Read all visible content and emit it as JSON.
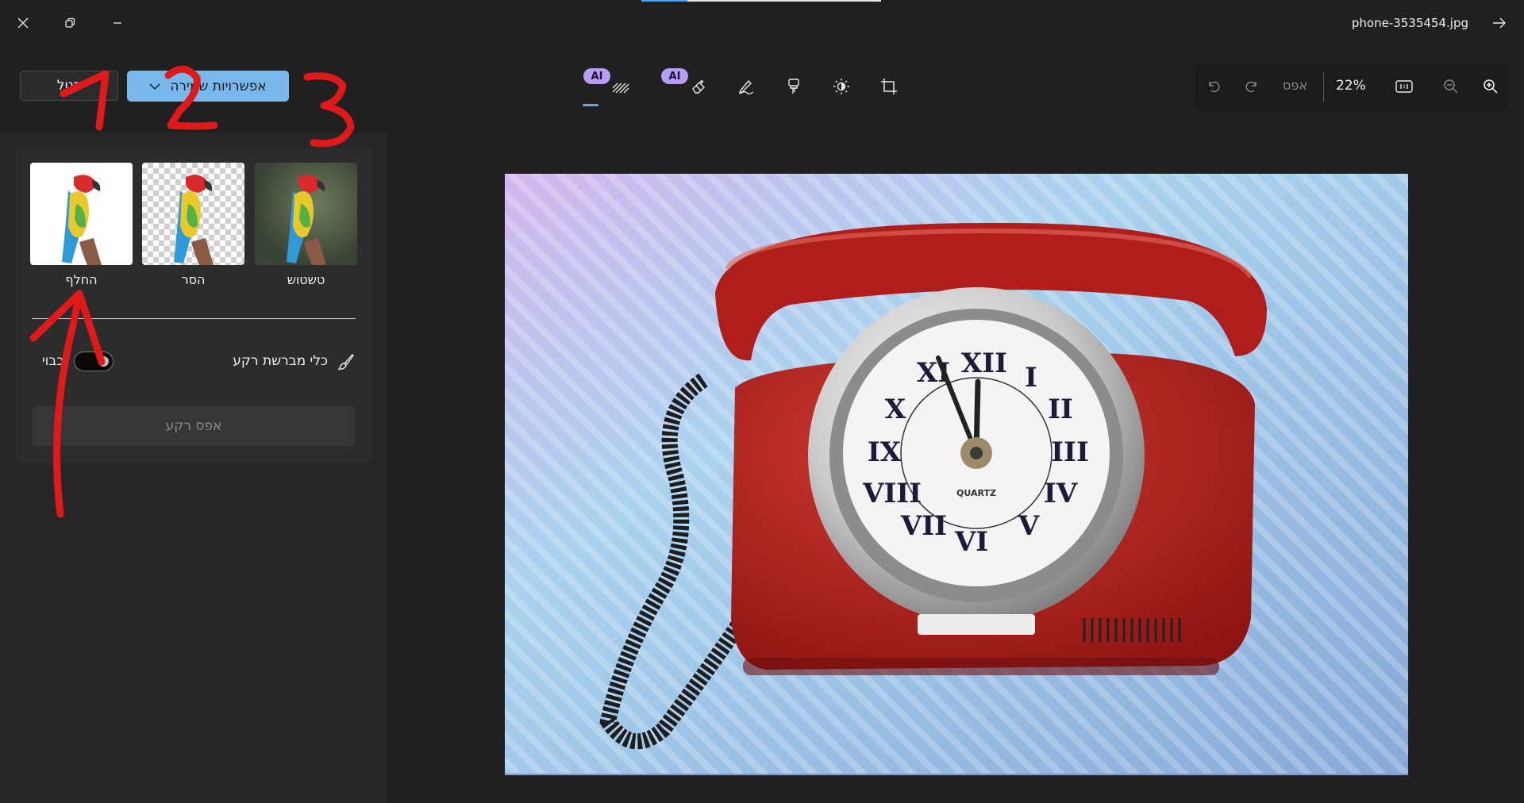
{
  "window": {
    "file_name": "phone-3535454.jpg",
    "close_icon": "close-icon",
    "restore_icon": "restore-icon",
    "minimize_icon": "minimize-icon",
    "forward_icon": "arrow-right-icon"
  },
  "actions": {
    "cancel_label": "בטל",
    "save_label": "אפשרויות שמירה",
    "save_dropdown_icon": "chevron-down-icon"
  },
  "tools": {
    "ai_badge": "AI",
    "items": [
      {
        "name": "background-tool",
        "icon": "background-icon",
        "ai": true,
        "selected": true
      },
      {
        "name": "erase-tool",
        "icon": "eraser-icon",
        "ai": true,
        "selected": false
      },
      {
        "name": "markup-tool",
        "icon": "pen-icon",
        "ai": false,
        "selected": false
      },
      {
        "name": "filter-tool",
        "icon": "filter-icon",
        "ai": false,
        "selected": false
      },
      {
        "name": "adjust-tool",
        "icon": "brightness-icon",
        "ai": false,
        "selected": false
      },
      {
        "name": "crop-tool",
        "icon": "crop-icon",
        "ai": false,
        "selected": false
      }
    ]
  },
  "zoom": {
    "undo_icon": "undo-icon",
    "redo_icon": "redo-icon",
    "reset_label": "אפס",
    "value": "22%",
    "actual_size_icon": "actual-size-icon",
    "zoom_out_icon": "zoom-out-icon",
    "zoom_in_icon": "zoom-in-icon"
  },
  "background_panel": {
    "options": [
      {
        "label": "טשטוש",
        "icon": "blur-background-thumbnail"
      },
      {
        "label": "הסר",
        "icon": "remove-background-thumbnail"
      },
      {
        "label": "החלף",
        "icon": "replace-background-thumbnail"
      }
    ],
    "brush_label": "כלי מברשת רקע",
    "brush_icon": "brush-icon",
    "toggle_label": "כבוי",
    "toggle_state": "off",
    "reset_label": "אפס רקע"
  },
  "annotations": {
    "one": "1",
    "two": "2",
    "three": "3",
    "color": "#e0191b"
  },
  "colors": {
    "accent": "#79b8ec",
    "ai_badge": "#b79df5",
    "background": "#202020",
    "phone_red": "#b01e1c"
  }
}
